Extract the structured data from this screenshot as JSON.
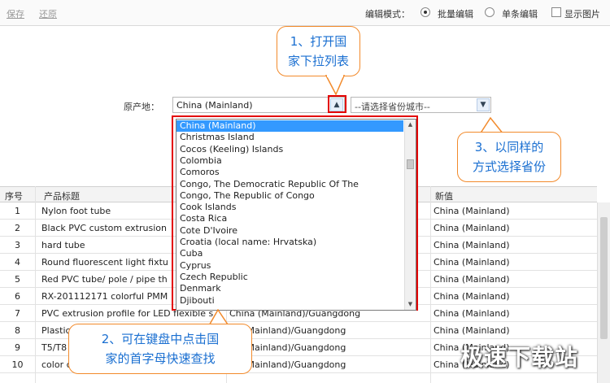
{
  "toolbar": {
    "save": "保存",
    "restore": "还原",
    "edit_mode_label": "编辑模式：",
    "batch_edit": "批量编辑",
    "single_edit": "单条编辑",
    "show_images": "显示图片"
  },
  "origin": {
    "label": "原产地：",
    "country_value": "China (Mainland)",
    "province_placeholder": "--请选择省份城市--"
  },
  "dropdown": {
    "items": [
      "China (Mainland)",
      "Christmas Island",
      "Cocos (Keeling) Islands",
      "Colombia",
      "Comoros",
      "Congo, The Democratic Republic Of The",
      "Congo, The Republic of Congo",
      "Cook Islands",
      "Costa Rica",
      "Cote D'Ivoire",
      "Croatia (local name: Hrvatska)",
      "Cuba",
      "Cyprus",
      "Czech Republic",
      "Denmark",
      "Djibouti"
    ],
    "selected_index": 0
  },
  "table": {
    "headers": {
      "index": "序号",
      "title": "产品标题",
      "new_value": "新值"
    },
    "rows": [
      {
        "n": "1",
        "title": "Nylon foot tube",
        "old": "",
        "new": "China (Mainland)"
      },
      {
        "n": "2",
        "title": "Black PVC custom extrusion",
        "old": "",
        "new": "China (Mainland)"
      },
      {
        "n": "3",
        "title": "hard tube",
        "old": "",
        "new": "China (Mainland)"
      },
      {
        "n": "4",
        "title": "Round fluorescent light fixtu",
        "old": "",
        "new": "China (Mainland)"
      },
      {
        "n": "5",
        "title": "Red PVC tube/ pole / pipe th",
        "old": "",
        "new": "China (Mainland)"
      },
      {
        "n": "6",
        "title": "RX-201112171 colorful PMM",
        "old": "",
        "new": "China (Mainland)"
      },
      {
        "n": "7",
        "title": "PVC extrusion profile for LED flexible s",
        "old": "China (Mainland)/Guangdong",
        "new": "China (Mainland)"
      },
      {
        "n": "8",
        "title": "Plastic",
        "old": "na (Mainland)/Guangdong",
        "new": "China (Mainland)"
      },
      {
        "n": "9",
        "title": "T5/T8",
        "old": "na (Mainland)/Guangdong",
        "new": "China (Mainland)"
      },
      {
        "n": "10",
        "title": "color c",
        "old": "na (Mainland)/Guangdong",
        "new": "China (Mainland)"
      }
    ]
  },
  "callouts": {
    "c1_line1": "1、打开国",
    "c1_line2": "家下拉列表",
    "c2_line1": "2、可在键盘中点击国",
    "c2_line2": "家的首字母快速查找",
    "c3_line1": "3、以同样的",
    "c3_line2": "方式选择省份"
  },
  "watermark": "极速下载站",
  "colors": {
    "accent_red": "#e30000",
    "callout_border": "#f28a2b",
    "callout_text": "#1a6fd1",
    "selection": "#3399ff"
  }
}
